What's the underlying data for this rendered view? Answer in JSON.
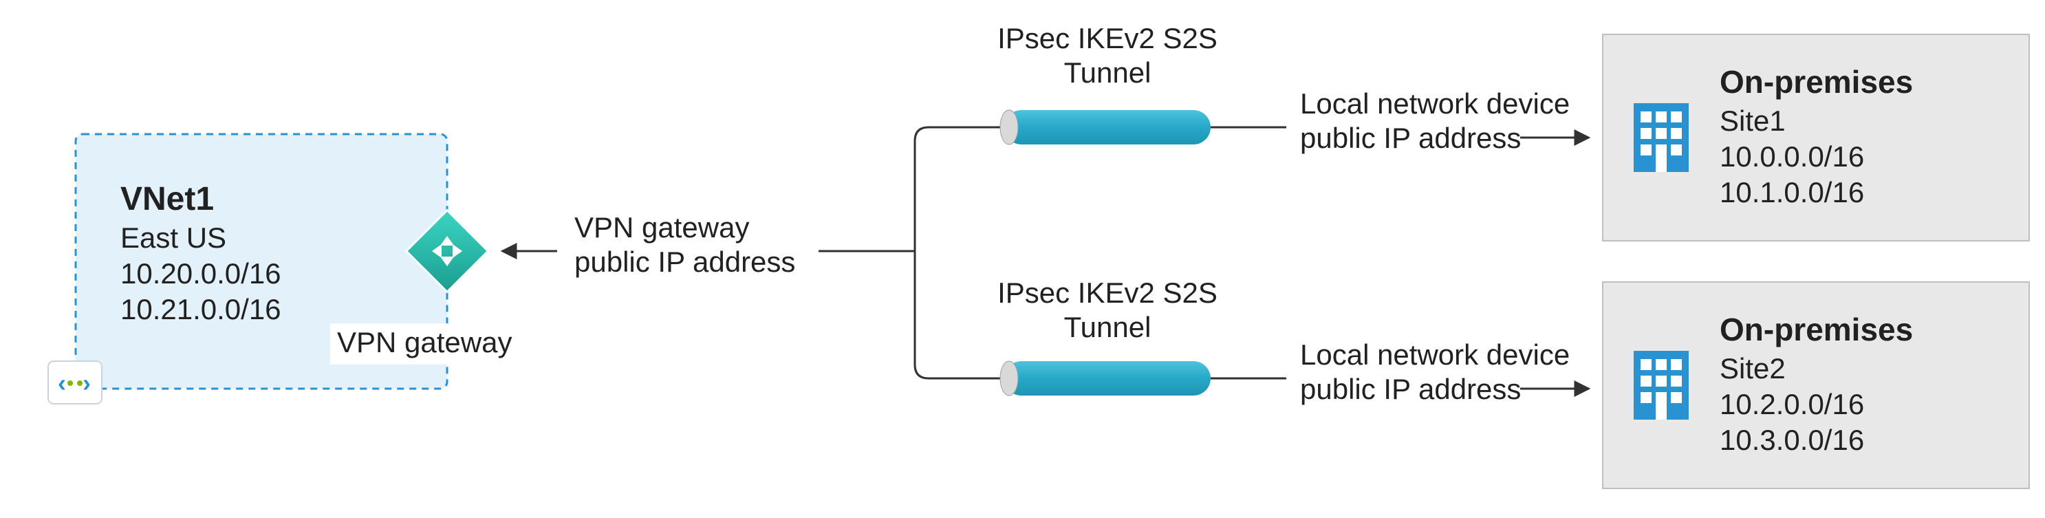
{
  "vnet": {
    "title": "VNet1",
    "region": "East US",
    "cidr1": "10.20.0.0/16",
    "cidr2": "10.21.0.0/16",
    "gatewayLabel": "VPN gateway"
  },
  "gateway": {
    "line1": "VPN gateway",
    "line2": "public IP address"
  },
  "tunnel1": {
    "line1": "IPsec IKEv2 S2S",
    "line2": "Tunnel"
  },
  "tunnel2": {
    "line1": "IPsec IKEv2 S2S",
    "line2": "Tunnel"
  },
  "local1": {
    "line1": "Local network device",
    "line2": "public IP address"
  },
  "local2": {
    "line1": "Local network device",
    "line2": "public IP address"
  },
  "site1": {
    "title": "On-premises",
    "name": "Site1",
    "cidr1": "10.0.0.0/16",
    "cidr2": "10.1.0.0/16"
  },
  "site2": {
    "title": "On-premises",
    "name": "Site2",
    "cidr1": "10.2.0.0/16",
    "cidr2": "10.3.0.0/16"
  }
}
